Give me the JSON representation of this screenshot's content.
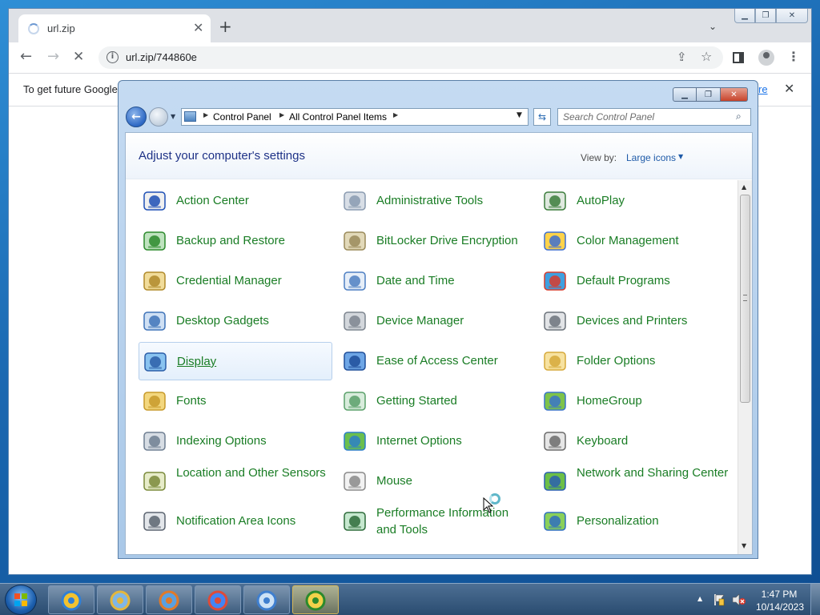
{
  "browser": {
    "tab_title": "url.zip",
    "tab_close": "✕",
    "new_tab": "+",
    "url": "url.zip/744860e",
    "infobar_text": "To get future Google",
    "infobar_link": "re",
    "infobar_close": "✕",
    "icons": [
      "loading-spinner-icon",
      "back-arrow-icon",
      "forward-arrow-icon",
      "stop-icon",
      "info-icon",
      "share-icon",
      "star-icon",
      "side-panel-icon",
      "profile-icon",
      "menu-icon"
    ]
  },
  "control_panel": {
    "breadcrumb": [
      "Control Panel",
      "All Control Panel Items"
    ],
    "search_placeholder": "Search Control Panel",
    "title": "Adjust your computer's settings",
    "view_by_label": "View by:",
    "view_by_value": "Large icons",
    "selected_item": "Display",
    "items": [
      {
        "label": "Action Center",
        "icon": "flag-icon"
      },
      {
        "label": "Administrative Tools",
        "icon": "admin-tools-icon"
      },
      {
        "label": "AutoPlay",
        "icon": "autoplay-icon"
      },
      {
        "label": "Backup and Restore",
        "icon": "backup-icon"
      },
      {
        "label": "BitLocker Drive Encryption",
        "icon": "bitlocker-icon"
      },
      {
        "label": "Color Management",
        "icon": "color-management-icon"
      },
      {
        "label": "Credential Manager",
        "icon": "credential-icon"
      },
      {
        "label": "Date and Time",
        "icon": "calendar-clock-icon"
      },
      {
        "label": "Default Programs",
        "icon": "default-programs-icon"
      },
      {
        "label": "Desktop Gadgets",
        "icon": "gadgets-icon"
      },
      {
        "label": "Device Manager",
        "icon": "device-manager-icon"
      },
      {
        "label": "Devices and Printers",
        "icon": "printer-icon"
      },
      {
        "label": "Display",
        "icon": "monitor-icon"
      },
      {
        "label": "Ease of Access Center",
        "icon": "ease-of-access-icon"
      },
      {
        "label": "Folder Options",
        "icon": "folder-icon"
      },
      {
        "label": "Fonts",
        "icon": "fonts-icon"
      },
      {
        "label": "Getting Started",
        "icon": "getting-started-icon"
      },
      {
        "label": "HomeGroup",
        "icon": "homegroup-icon"
      },
      {
        "label": "Indexing Options",
        "icon": "indexing-icon"
      },
      {
        "label": "Internet Options",
        "icon": "globe-icon"
      },
      {
        "label": "Keyboard",
        "icon": "keyboard-icon"
      },
      {
        "label": "Location and Other Sensors",
        "icon": "location-icon"
      },
      {
        "label": "Mouse",
        "icon": "mouse-icon"
      },
      {
        "label": "Network and Sharing Center",
        "icon": "network-icon"
      },
      {
        "label": "Notification Area Icons",
        "icon": "notification-icon"
      },
      {
        "label": "Performance Information and Tools",
        "icon": "performance-icon"
      },
      {
        "label": "Personalization",
        "icon": "personalization-icon"
      }
    ]
  },
  "taskbar": {
    "apps": [
      {
        "name": "Internet Explorer",
        "icon": "ie-icon"
      },
      {
        "name": "Windows Explorer",
        "icon": "explorer-icon"
      },
      {
        "name": "Media Player",
        "icon": "media-player-icon"
      },
      {
        "name": "Google Chrome",
        "icon": "chrome-icon"
      },
      {
        "name": "Control Panel",
        "icon": "control-panel-icon"
      },
      {
        "name": "Action Center",
        "icon": "action-center-icon"
      }
    ],
    "time": "1:47 PM",
    "date": "10/14/2023"
  },
  "colors": {
    "item_link": "#1a7d25",
    "header_title": "#1e3287",
    "accent": "#1e5aa8"
  }
}
